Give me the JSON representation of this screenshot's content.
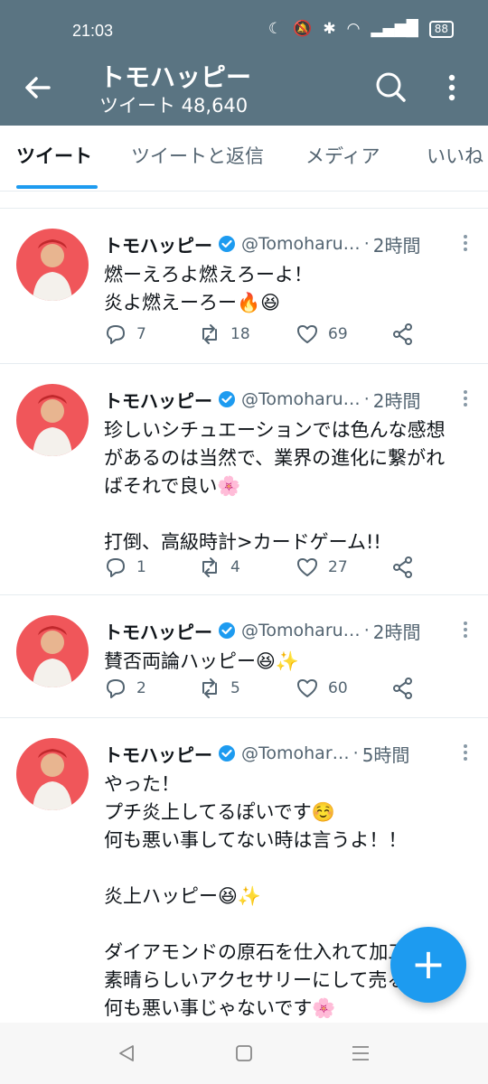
{
  "status_bar": {
    "time": "21:03",
    "battery": "88"
  },
  "header": {
    "title": "トモハッピー",
    "subtitle": "ツイート 48,640"
  },
  "tabs": [
    {
      "label": "ツイート"
    },
    {
      "label": "ツイートと返信"
    },
    {
      "label": "メディア"
    },
    {
      "label": "いいね"
    }
  ],
  "tweets": [
    {
      "name": "トモハッピー",
      "handle": "@Tomoharu…",
      "time": "2時間",
      "lines": [
        "燃ーえろよ燃えろーよ！",
        "炎よ燃えーろー🔥😆"
      ],
      "replies": "7",
      "retweets": "18",
      "likes": "69"
    },
    {
      "name": "トモハッピー",
      "handle": "@Tomoharu…",
      "time": "2時間",
      "lines": [
        "珍しいシチュエーションでは色んな感想",
        "があるのは当然で、業界の進化に繋がれ",
        "ばそれで良い🌸",
        "",
        "打倒、高級時計>カードゲーム!!"
      ],
      "replies": "1",
      "retweets": "4",
      "likes": "27"
    },
    {
      "name": "トモハッピー",
      "handle": "@Tomoharu…",
      "time": "2時間",
      "lines": [
        "賛否両論ハッピー😆✨"
      ],
      "replies": "2",
      "retweets": "5",
      "likes": "60"
    },
    {
      "name": "トモハッピー",
      "handle": "@Tomohar…",
      "time": "5時間",
      "lines": [
        "やった！",
        "プチ炎上してるぽいです☺️",
        "何も悪い事してない時は言うよ！！",
        "",
        "炎上ハッピー😆✨",
        "",
        "ダイアモンドの原石を仕入れて加工して",
        "素晴らしいアクセサリーにして売る",
        "何も悪い事じゃないです🌸"
      ]
    }
  ],
  "colors": {
    "header_bg": "#5a7482",
    "accent": "#1d9bf0",
    "avatar_bg": "#f0565a"
  }
}
